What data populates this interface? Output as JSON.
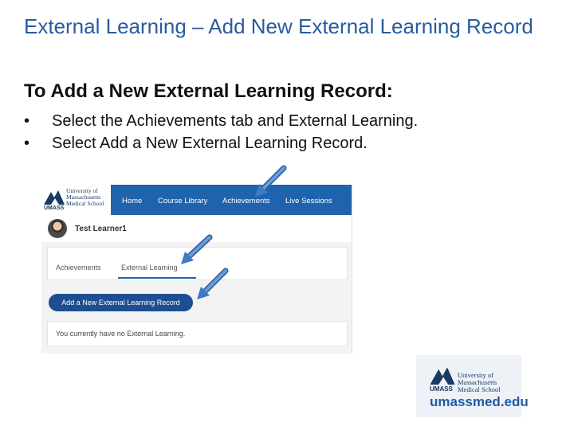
{
  "slide": {
    "title": "External Learning – Add New External Learning Record",
    "subheading": "To Add a New External Learning Record:",
    "bullets": [
      "Select the Achievements tab and External Learning.",
      "Select Add a New External Learning Record."
    ],
    "bullet_glyph": "•"
  },
  "screenshot": {
    "logo": {
      "lines": [
        "University of",
        "Massachusetts",
        "Medical School"
      ],
      "wordmark": "UMASS"
    },
    "nav": [
      "Home",
      "Course Library",
      "Achievements",
      "Live Sessions"
    ],
    "user_name": "Test Learner1",
    "tabs": [
      "Achievements",
      "External Learning"
    ],
    "add_button": "Add a New External Learning Record",
    "empty_message": "You currently have no External Learning.",
    "colors": {
      "nav": "#2063ad",
      "button": "#1d4e8f"
    }
  },
  "footer_logo": {
    "lines": [
      "University of",
      "Massachusetts",
      "Medical School"
    ],
    "wordmark": "UMASS",
    "url": "umassmed.edu"
  },
  "colors": {
    "title": "#2a5b9e",
    "arrow": "#3d7cc4"
  }
}
